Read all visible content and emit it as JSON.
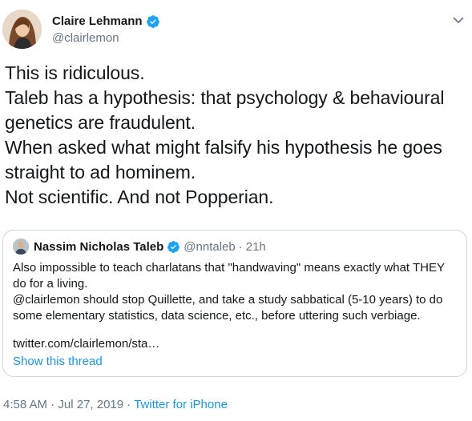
{
  "author": {
    "display_name": "Claire Lehmann",
    "handle": "@clairlemon",
    "avatar_icon": "user-avatar-photo",
    "verified_icon": "verified-badge-icon"
  },
  "tweet_lines": [
    "This is ridiculous.",
    "Taleb has a hypothesis: that psychology & behavioural",
    "genetics are fraudulent.",
    "When asked what might falsify his hypothesis he goes",
    "straight to ad hominem.",
    "Not scientific. And not Popperian."
  ],
  "quoted": {
    "display_name": "Nassim Nicholas Taleb",
    "handle": "@nntaleb",
    "separator": "·",
    "time": "21h",
    "lines": [
      "Also impossible to teach charlatans that \"handwaving\" means exactly what THEY",
      "do for a living.",
      "@clairlemon should stop Quillette, and take a study sabbatical (5-10 years) to do",
      "some elementary statistics, data science, etc., before uttering such verbiage."
    ],
    "link": "twitter.com/clairlemon/sta…",
    "show_thread": "Show this thread"
  },
  "meta": {
    "time": "4:58 AM",
    "separator": "·",
    "date": "Jul 27, 2019",
    "source": "Twitter for iPhone"
  },
  "colors": {
    "text": "#14171a",
    "secondary": "#657786",
    "link": "#1b95e0",
    "verified": "#1da1f2",
    "border": "#ccd6dd"
  }
}
